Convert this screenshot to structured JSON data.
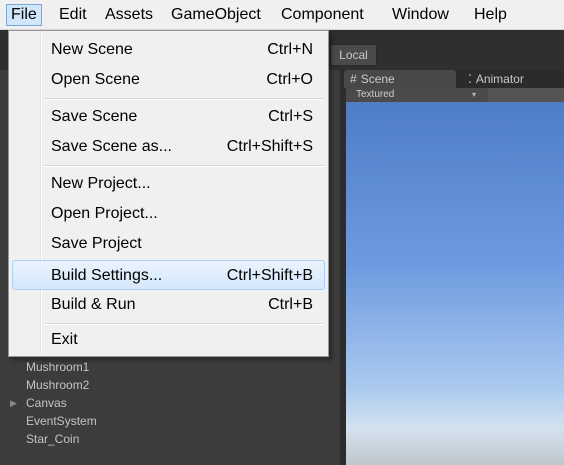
{
  "menubar": {
    "items": [
      {
        "label": "File",
        "active": true
      },
      {
        "label": "Edit"
      },
      {
        "label": "Assets"
      },
      {
        "label": "GameObject"
      },
      {
        "label": "Component"
      },
      {
        "label": "Window"
      },
      {
        "label": "Help"
      }
    ]
  },
  "toolbar": {
    "local_label": "Local"
  },
  "tabs": {
    "scene": {
      "glyph": "#",
      "label": "Scene"
    },
    "animator": {
      "glyph": "⁚",
      "label": "Animator"
    },
    "menu_glyph": "≡"
  },
  "scene": {
    "shading_mode": "Textured",
    "shading_arrow": "▾"
  },
  "hierarchy": {
    "items": [
      {
        "label": "Mushroom1"
      },
      {
        "label": "Mushroom2"
      },
      {
        "label": "Canvas",
        "foldout": "▶"
      },
      {
        "label": "EventSystem"
      },
      {
        "label": "Star_Coin"
      }
    ]
  },
  "file_menu": {
    "items": [
      {
        "label": "New Scene",
        "shortcut": "Ctrl+N"
      },
      {
        "label": "Open Scene",
        "shortcut": "Ctrl+O"
      },
      {
        "label": "Save Scene",
        "shortcut": "Ctrl+S"
      },
      {
        "label": "Save Scene as...",
        "shortcut": "Ctrl+Shift+S"
      },
      {
        "label": "New Project...",
        "shortcut": ""
      },
      {
        "label": "Open Project...",
        "shortcut": ""
      },
      {
        "label": "Save Project",
        "shortcut": ""
      },
      {
        "label": "Build Settings...",
        "shortcut": "Ctrl+Shift+B",
        "highlighted": true
      },
      {
        "label": "Build & Run",
        "shortcut": "Ctrl+B"
      },
      {
        "label": "Exit",
        "shortcut": ""
      }
    ]
  },
  "colors": {
    "menu_highlight": "#d5e8fb",
    "editor_dark": "#3c3c3c",
    "sky_top": "#4f7dc6"
  }
}
